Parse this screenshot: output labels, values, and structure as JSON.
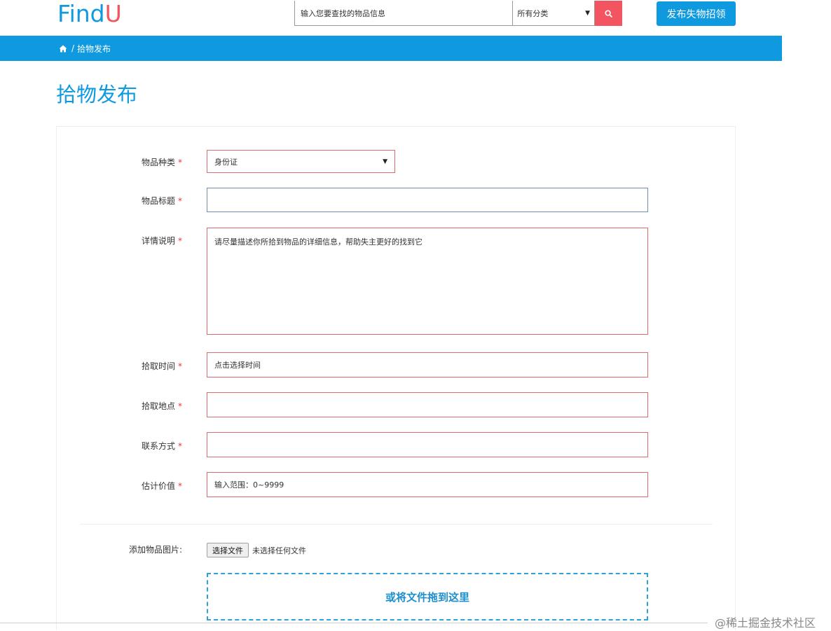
{
  "header": {
    "logo_part1": "Find",
    "logo_part2": "U",
    "search_placeholder": "输入您要查找的物品信息",
    "category_selected": "所有分类",
    "search_icon": "search-icon",
    "publish_button": "发布失物招领"
  },
  "breadcrumb": {
    "home_icon": "home-icon",
    "separator": "/",
    "current": "拾物发布"
  },
  "page_title": "拾物发布",
  "form": {
    "item_type": {
      "label": "物品种类",
      "required": "*",
      "value": "身份证"
    },
    "item_title": {
      "label": "物品标题",
      "required": "*",
      "value": ""
    },
    "details": {
      "label": "详情说明",
      "required": "*",
      "placeholder": "请尽量描述你所拾到物品的详细信息，帮助失主更好的找到它"
    },
    "pick_time": {
      "label": "拾取时间",
      "required": "*",
      "placeholder": "点击选择时间"
    },
    "pick_place": {
      "label": "拾取地点",
      "required": "*",
      "value": ""
    },
    "contact": {
      "label": "联系方式",
      "required": "*",
      "value": ""
    },
    "value": {
      "label": "估计价值",
      "required": "*",
      "placeholder": "输入范围：0~9999"
    },
    "image": {
      "label": "添加物品图片:",
      "choose_button": "选择文件",
      "status": "未选择任何文件",
      "dropzone": "或将文件拖到这里"
    }
  },
  "watermark": "@稀土掘金技术社区",
  "colors": {
    "brand_blue": "#0f9ae0",
    "brand_red": "#f25560",
    "required_red": "#e0393e"
  }
}
